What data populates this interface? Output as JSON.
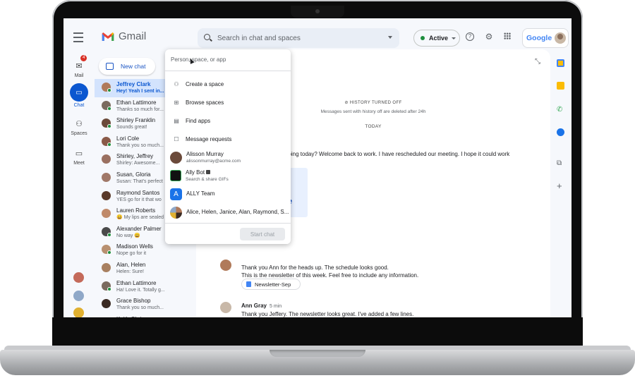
{
  "app": {
    "name": "Gmail"
  },
  "search": {
    "placeholder": "Search in chat and spaces"
  },
  "status": {
    "label": "Active"
  },
  "account": {
    "brand": "Google"
  },
  "rail": {
    "mail": {
      "label": "Mail",
      "badge": "4"
    },
    "chat": {
      "label": "Chat"
    },
    "spaces": {
      "label": "Spaces"
    },
    "meet": {
      "label": "Meet"
    }
  },
  "new_chat": {
    "label": "New chat"
  },
  "chats": [
    {
      "name": "Jeffrey Clark",
      "preview": "Hey! Yeah I sent in...",
      "color": "#b07a5a",
      "online": true,
      "selected": true
    },
    {
      "name": "Ethan Lattimore",
      "preview": "Thanks so much for...",
      "color": "#7a6a5e",
      "online": true
    },
    {
      "name": "Shirley Franklin",
      "preview": "Sounds great!",
      "color": "#6b4a3a",
      "online": true
    },
    {
      "name": "Lori Cole",
      "preview": "Thank you so much...",
      "color": "#8a5a48",
      "online": true
    },
    {
      "name": "Shirley, Jeffrey",
      "preview": "Shirley: Awesome...",
      "color": "#9a7060",
      "online": false
    },
    {
      "name": "Susan, Gloria",
      "preview": "Susan: That's perfect",
      "color": "#a07868",
      "online": false
    },
    {
      "name": "Raymond Santos",
      "preview": "YES go for it that wo",
      "color": "#5a3a2a",
      "online": false
    },
    {
      "name": "Lauren Roberts",
      "preview": "😀 My lips are sealed",
      "color": "#c08a6a",
      "online": false
    },
    {
      "name": "Alexander Palmer",
      "preview": "No way 😀",
      "color": "#4a4a4a",
      "online": true
    },
    {
      "name": "Madison Wells",
      "preview": "Nope go for it",
      "color": "#b89070",
      "online": true
    },
    {
      "name": "Alan, Helen",
      "preview": "Helen: Sure!",
      "color": "#a88060",
      "online": false
    },
    {
      "name": "Ethan Lattimore",
      "preview": "Ha! Love it. Totally g...",
      "color": "#7a6a5e",
      "online": true
    },
    {
      "name": "Grace Bishop",
      "preview": "Thank you so much...",
      "color": "#3a2a22",
      "online": false
    },
    {
      "name": "Keith Obrien",
      "preview": "",
      "color": "#6a5a50",
      "online": false
    }
  ],
  "conversation": {
    "history_title": "HISTORY TURNED OFF",
    "history_sub": "Messages sent with history off are deleted after 24h",
    "day": "TODAY",
    "msg1": "going today? Welcome back to work. I have rescheduled our meeting. I hope it could work",
    "gif_word": "ne",
    "msg2_line1": "Thank you Ann for the heads up. The schedule looks good.",
    "msg2_line2": "This is the newsletter of this week. Feel free to include any information.",
    "attachment": "Newsletter-Sep",
    "msg3_author": "Ann Gray",
    "msg3_time": "5 min",
    "msg3_text": "Thank you Jeffery. The newsletter looks great. I've added a few lines."
  },
  "popup": {
    "placeholder": "Person, space, or app",
    "items": [
      {
        "label": "Create a space",
        "icon": "create-space-icon"
      },
      {
        "label": "Browse spaces",
        "icon": "browse-spaces-icon"
      },
      {
        "label": "Find apps",
        "icon": "find-apps-icon"
      },
      {
        "label": "Message requests",
        "icon": "message-requests-icon"
      }
    ],
    "people": [
      {
        "name": "Alisson Murray",
        "sub": "alissonmurray@acme.com"
      },
      {
        "name": "Ally Bot",
        "sub": "Search & share GIFs"
      },
      {
        "name": "ALLY Team",
        "sub": ""
      },
      {
        "name": "Alice, Helen, Janice, Alan, Raymond, S...",
        "sub": ""
      }
    ],
    "start_button": "Start chat"
  },
  "colors": {
    "accent": "#0b57d0",
    "selected_row": "#d3e3fd",
    "online": "#1e8e3e",
    "badge": "#d93025"
  }
}
